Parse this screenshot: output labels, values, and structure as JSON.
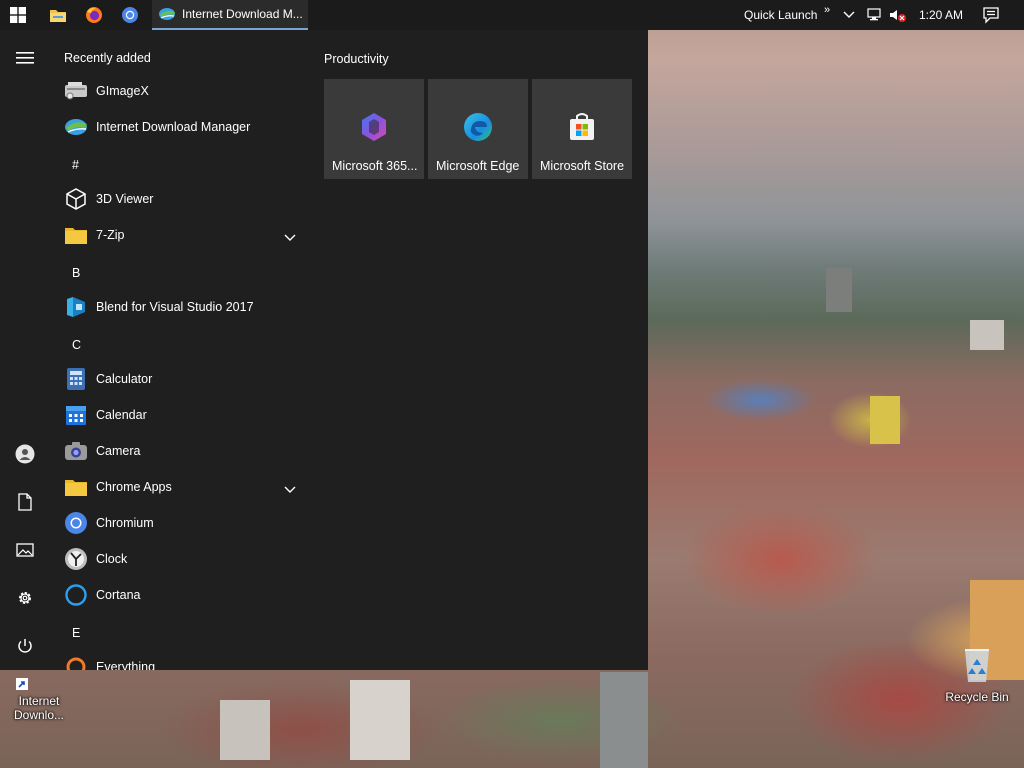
{
  "taskbar": {
    "active_window_label": "Internet Download M...",
    "quick_launch": "Quick Launch",
    "quick_launch_chevrons": "»",
    "clock": "1:20 AM"
  },
  "start_menu": {
    "recently_added_title": "Recently added",
    "recent": [
      {
        "label": "GImageX",
        "icon": "gimagex-icon"
      },
      {
        "label": "Internet Download Manager",
        "icon": "idm-icon"
      }
    ],
    "groups": [
      {
        "letter": "#",
        "apps": [
          {
            "label": "3D Viewer",
            "icon": "3d-viewer-icon"
          },
          {
            "label": "7-Zip",
            "icon": "folder-icon",
            "expandable": true
          }
        ]
      },
      {
        "letter": "B",
        "apps": [
          {
            "label": "Blend for Visual Studio 2017",
            "icon": "blend-icon"
          }
        ]
      },
      {
        "letter": "C",
        "apps": [
          {
            "label": "Calculator",
            "icon": "calculator-icon"
          },
          {
            "label": "Calendar",
            "icon": "calendar-icon"
          },
          {
            "label": "Camera",
            "icon": "camera-icon"
          },
          {
            "label": "Chrome Apps",
            "icon": "folder-icon",
            "expandable": true
          },
          {
            "label": "Chromium",
            "icon": "chromium-icon"
          },
          {
            "label": "Clock",
            "icon": "clock-icon"
          },
          {
            "label": "Cortana",
            "icon": "cortana-icon"
          }
        ]
      },
      {
        "letter": "E",
        "apps": [
          {
            "label": "Everything",
            "icon": "everything-icon"
          }
        ]
      }
    ],
    "tiles_title": "Productivity",
    "tiles": [
      {
        "label": "Microsoft 365...",
        "icon": "microsoft-365-icon"
      },
      {
        "label": "Microsoft Edge",
        "icon": "edge-icon"
      },
      {
        "label": "Microsoft Store",
        "icon": "store-icon"
      }
    ]
  },
  "desktop": {
    "icons": [
      {
        "label": "Internet Downlo..."
      },
      {
        "label": "Recycle Bin"
      }
    ]
  },
  "colors": {
    "taskbar_bg": "#1b1b1b",
    "start_bg": "#1f1f1f",
    "tile_bg": "#3a3a3a",
    "accent": "#3a7bd5"
  }
}
